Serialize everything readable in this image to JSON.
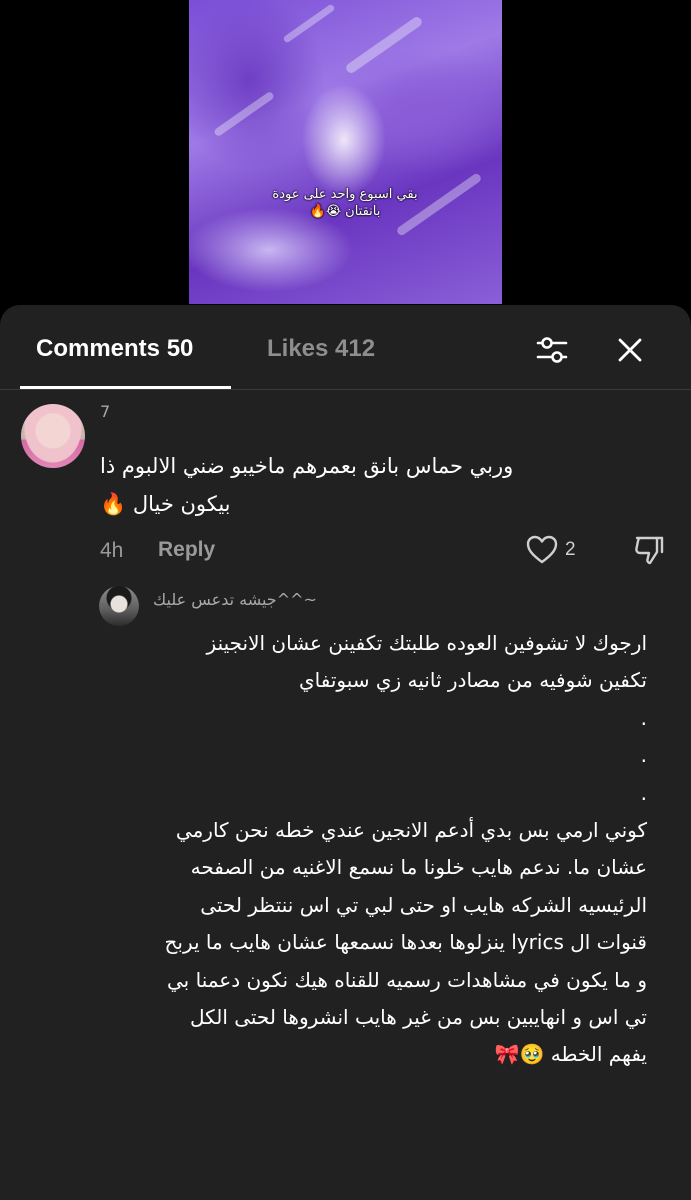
{
  "video": {
    "caption_line1": "بقي اسبوع واحد على عودة",
    "caption_line2": "بانقتان 😭🔥"
  },
  "tabs": {
    "comments_label": "Comments 50",
    "likes_label": "Likes 412"
  },
  "icons": {
    "filter": "sliders-icon",
    "close": "close-icon",
    "like": "heart-icon",
    "dislike": "thumbs-down-icon"
  },
  "comment": {
    "username": "7",
    "text": "وربي حماس بانق بعمرهم ماخيبو ضني الالبوم ذا بيكون خيال 🔥",
    "time": "4h",
    "reply_label": "Reply",
    "like_count": "2"
  },
  "reply": {
    "username": "جيشه تدعس عليك^^~",
    "text": "ارجوك لا تشوفين العوده طلبتك تكفينن عشان الانجينز\nتكفين شوفيه من مصادر ثانيه زي سبوتفاي\n.\n.\n.\nكوني ارمي بس بدي أدعم الانجين عندي خطه نحن كارمي عشان ما. ندعم هايب خلونا ما نسمع الاغنيه من الصفحه الرئيسيه الشركه هايب او حتى لبي تي اس ننتظر لحتى قنوات ال lyrics ينزلوها بعدها نسمعها عشان هايب ما يربح و ما يكون في مشاهدات رسميه للقناه هيك نكون دعمنا بي تي اس و انهايبين بس من غير هايب انشروها لحتى الكل يفهم الخطه 🥹🎀"
  },
  "colors": {
    "sheet_bg": "#212121",
    "muted_text": "#9a9a9a",
    "accent_purple": "#8b5cd8"
  }
}
